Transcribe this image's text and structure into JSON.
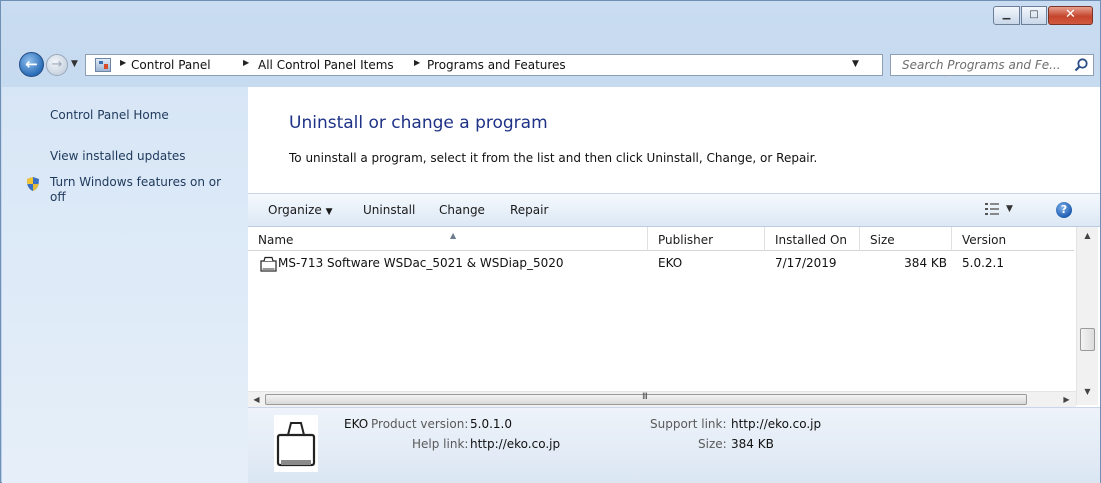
{
  "window": {
    "minimize_glyph": "▁",
    "maximize_glyph": "□",
    "close_glyph": "✕"
  },
  "navigation": {
    "back_glyph": "←",
    "forward_glyph": "→",
    "breadcrumbs": [
      "Control Panel",
      "All Control Panel Items",
      "Programs and Features"
    ],
    "refresh_glyph": "⟲"
  },
  "search": {
    "placeholder": "Search Programs and Fe..."
  },
  "left_pane": {
    "links": [
      "Control Panel Home",
      "View installed updates",
      "Turn Windows features on or",
      "off"
    ]
  },
  "main": {
    "title": "Uninstall or change a program",
    "instructions": "To uninstall a program, select it from the list and then click Uninstall, Change, or Repair."
  },
  "toolbar": {
    "organize": "Organize",
    "uninstall": "Uninstall",
    "change": "Change",
    "repair": "Repair",
    "help_glyph": "?"
  },
  "columns": [
    "Name",
    "Publisher",
    "Installed On",
    "Size",
    "Version"
  ],
  "programs": [
    {
      "name": "MS-713 Software WSDac_5021 & WSDiap_5020",
      "publisher": "EKO",
      "installed_on": "7/17/2019",
      "size": "384 KB",
      "version": "5.0.2.1"
    }
  ],
  "scrollbar": {
    "grip": "III"
  },
  "details": {
    "publisher": "EKO",
    "product_version_label": "Product version:",
    "product_version": "5.0.1.0",
    "help_link_label": "Help link:",
    "help_link": "http://eko.co.jp",
    "support_link_label": "Support link:",
    "support_link": "http://eko.co.jp",
    "size_label": "Size:",
    "size": "384 KB"
  },
  "colors": {
    "title_blue": "#1e3287",
    "link_blue": "#1e395b",
    "left_pane_bg": "#d7e6f6"
  }
}
